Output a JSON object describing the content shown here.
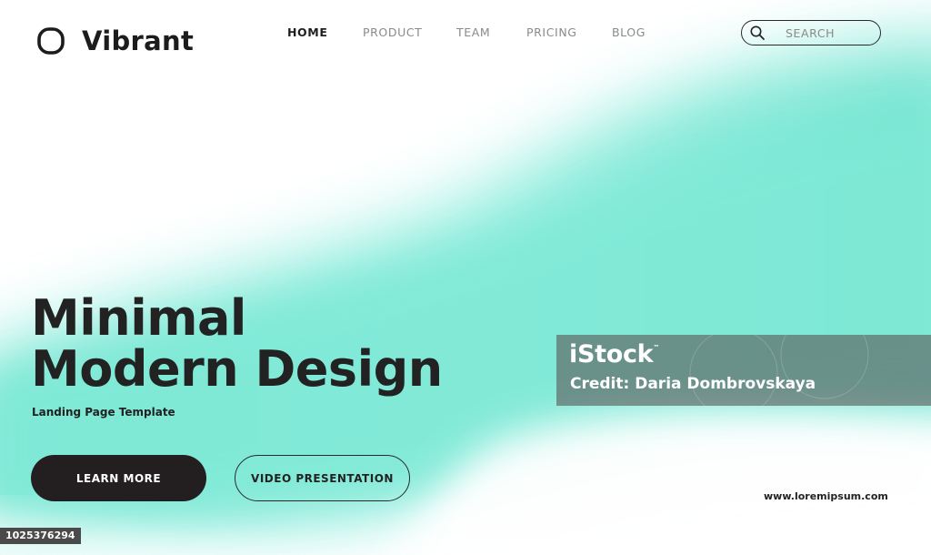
{
  "brand": {
    "name": "Vibrant",
    "logo_icon": "rounded-square-ring-icon"
  },
  "nav": {
    "items": [
      {
        "label": "HOME",
        "active": true
      },
      {
        "label": "PRODUCT",
        "active": false
      },
      {
        "label": "TEAM",
        "active": false
      },
      {
        "label": "PRICING",
        "active": false
      },
      {
        "label": "BLOG",
        "active": false
      }
    ]
  },
  "search": {
    "placeholder": "SEARCH",
    "icon": "search-icon"
  },
  "hero": {
    "title_line1": "Minimal",
    "title_line2": "Modern Design",
    "subtitle": "Landing Page Template",
    "primary_button": "LEARN MORE",
    "secondary_button": "VIDEO PRESENTATION"
  },
  "footer": {
    "url": "www.loremipsum.com"
  },
  "watermark": {
    "brand": "iStock",
    "trademark": "™",
    "credit": "Credit: Daria Dombrovskaya",
    "image_id": "1025376294"
  },
  "colors": {
    "accent": "#6ee6cf",
    "dark": "#231f20",
    "text_muted": "#8a8a8a"
  }
}
